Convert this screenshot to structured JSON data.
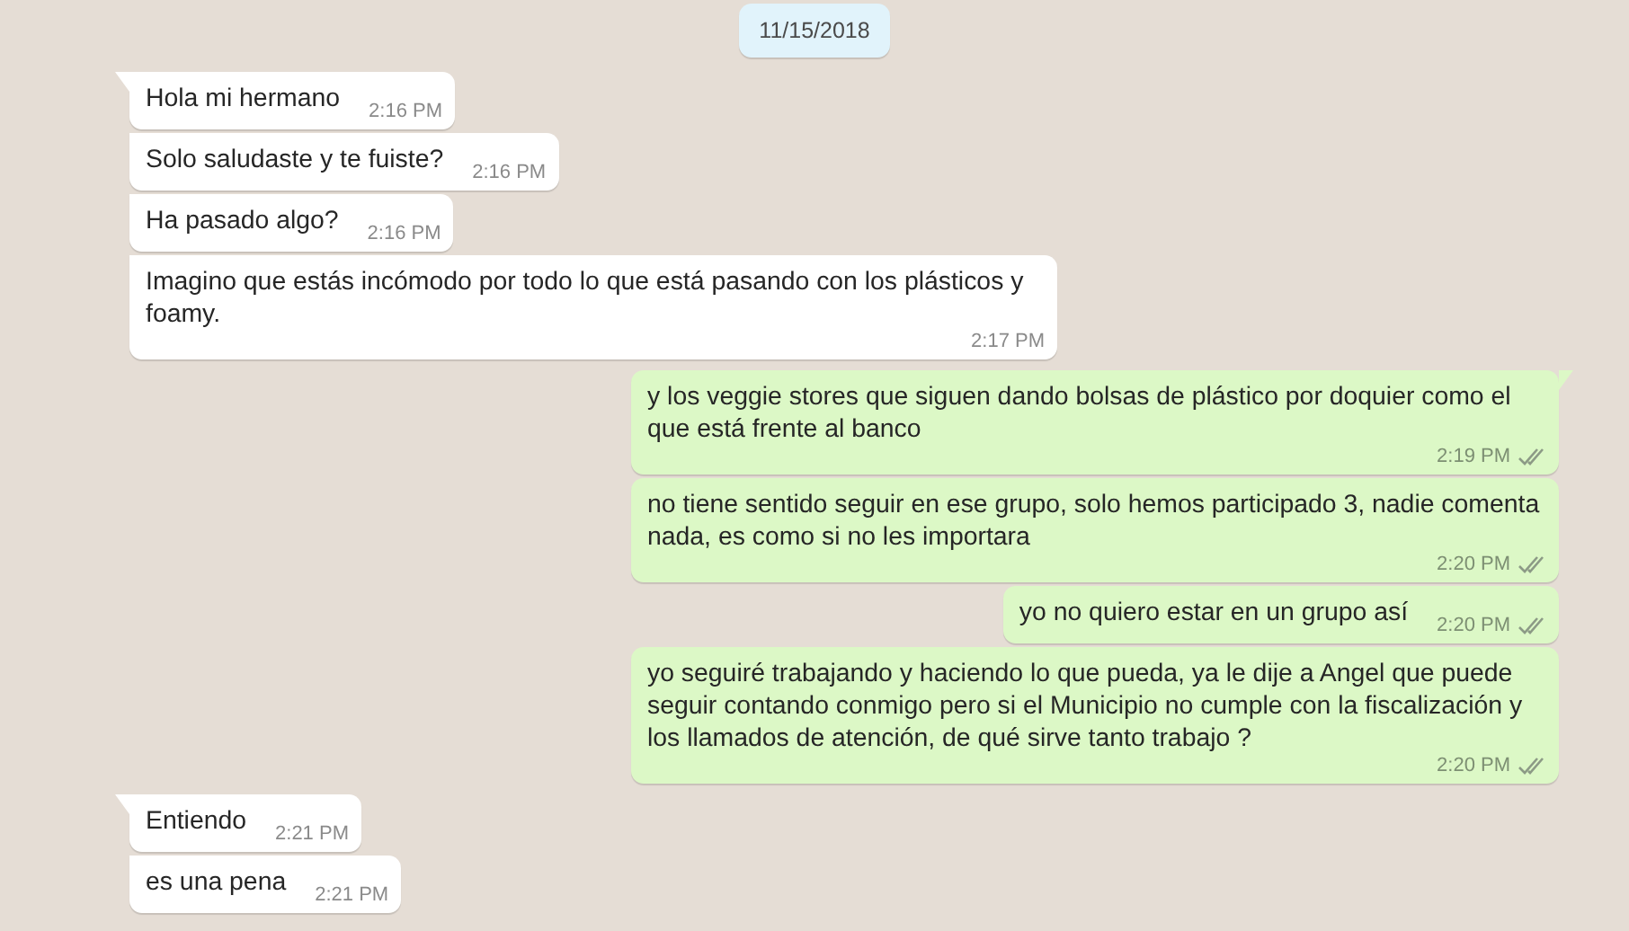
{
  "date_chip": "11/15/2018",
  "messages": [
    {
      "kind": "incoming",
      "tail": true,
      "text": "Hola mi hermano",
      "time": "2:16 PM"
    },
    {
      "kind": "incoming",
      "tail": false,
      "text": "Solo saludaste y te fuiste?",
      "time": "2:16 PM"
    },
    {
      "kind": "incoming",
      "tail": false,
      "text": "Ha pasado algo?",
      "time": "2:16 PM"
    },
    {
      "kind": "incoming",
      "tail": false,
      "text": "Imagino que estás incómodo por todo lo que está pasando con los plásticos y foamy.",
      "time": "2:17 PM"
    },
    {
      "kind": "outgoing",
      "tail": true,
      "text": "y los veggie stores que siguen dando bolsas de plástico por doquier como el que está frente al banco",
      "time": "2:19 PM",
      "read": false
    },
    {
      "kind": "outgoing",
      "tail": false,
      "text": "no tiene sentido seguir en ese grupo, solo hemos participado 3, nadie comenta nada, es como si no les importara",
      "time": "2:20 PM",
      "read": false
    },
    {
      "kind": "outgoing",
      "tail": false,
      "text": "yo no quiero estar en un grupo así",
      "time": "2:20 PM",
      "read": false
    },
    {
      "kind": "outgoing",
      "tail": false,
      "text": "yo seguiré trabajando y haciendo lo que pueda, ya le dije a Angel que puede seguir contando conmigo pero si el Municipio no cumple con la fiscalización y los llamados de atención, de qué sirve tanto trabajo ?",
      "time": "2:20 PM",
      "read": false
    },
    {
      "kind": "incoming",
      "tail": true,
      "text": "Entiendo",
      "time": "2:21 PM"
    },
    {
      "kind": "incoming",
      "tail": false,
      "text": "es una pena",
      "time": "2:21 PM"
    }
  ]
}
